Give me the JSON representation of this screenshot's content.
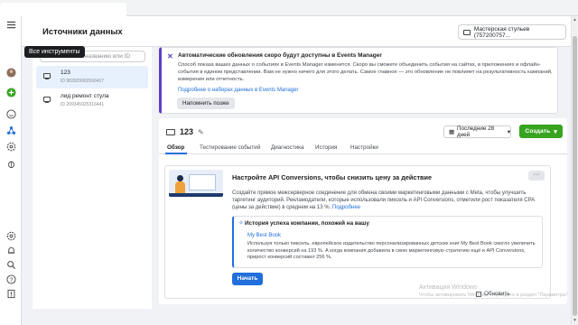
{
  "header": {
    "title": "Источники данных",
    "account": "Мастерская стульев (757200757..."
  },
  "rail": {
    "tooltip": "Все инструменты",
    "icons": [
      "menu-icon",
      "avatar",
      "add-icon",
      "smile-icon",
      "tools-icon",
      "settings-gear-icon",
      "bug-icon",
      "settings-icon",
      "notifications-icon",
      "search-icon",
      "help-icon",
      "report-icon"
    ]
  },
  "left_panel": {
    "search_placeholder": "Поиск по названию или ID",
    "items": [
      {
        "name": "123",
        "id": "ID 983929902566407"
      },
      {
        "name": "лид ремонт стула",
        "id": "ID 209345925316441"
      }
    ]
  },
  "notice": {
    "title": "Автоматические обновления скоро будут доступны в Events Manager",
    "body": "Способ показа ваших данных о событиях в Events Manager изменится. Скоро вы сможете объединить события на сайтах, в приложениях и офлайн-события в едином представлении. Вам не нужно ничего для этого делать. Самое главное — это обновление не повлияет на результативность кампаний, измерения или отчетность.",
    "link": "Подробнее о наборах данных в Events Manager",
    "remind_label": "Напомнить позже"
  },
  "dataset": {
    "name": "123",
    "date_range": "Последние 28 дней",
    "create_label": "Создать",
    "tabs": [
      "Обзор",
      "Тестирование событий",
      "Диагностика",
      "История",
      "Настройки"
    ]
  },
  "capi": {
    "title": "Настройте API Conversions, чтобы снизить цену за действие",
    "more": "···",
    "text": "Создайте прямое межсерверное соединение для обмена своими маркетинговыми данными с Meta, чтобы улучшить таргетинг аудиторий. Рекламодатели, которые использовали пиксель и API Conversions, отметили рост показателя CPA (цены за действие) в среднем на 13 %.",
    "text_link": "Подробнее",
    "story_title": "История успеха компании, похожей на вашу",
    "story_link": "My Best Book",
    "story_text": "Используя только пиксель, европейское издательство персонализированных детских книг My Best Book смогло увеличить количество конверсий на 193 %. А когда компания добавила в свою маркетинговую стратегию ещё и API Conversions, прирост конверсий составил 256 %.",
    "start_label": "Начать"
  },
  "footer": {
    "watermark_title": "Активация Windows",
    "watermark_sub": "Чтобы активировать Windows, перейдите в раздел \"Параметры\"",
    "footer_label": "Обновить"
  },
  "colors": {
    "accent": "#216fdb",
    "green": "#36a420",
    "notice": "#5b3fc4"
  }
}
